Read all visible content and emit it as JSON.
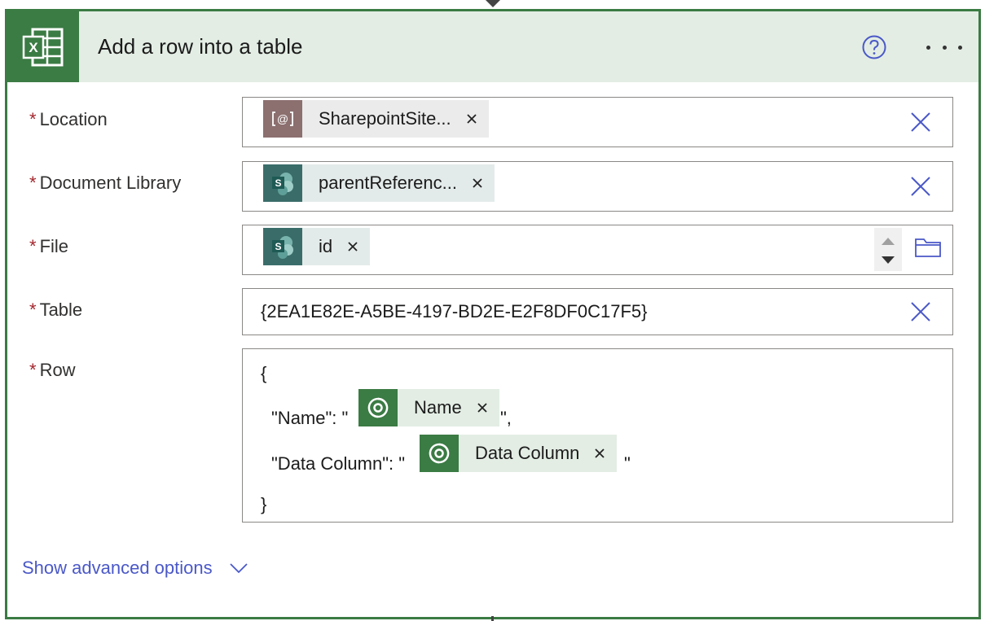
{
  "header": {
    "title": "Add a row into a table",
    "app_icon": "excel-icon",
    "help_icon": "help-circle-icon",
    "more_icon": "more-ellipsis-icon",
    "brand_color": "#3b7b44"
  },
  "required_marker": "*",
  "fields": {
    "location": {
      "label": "Location",
      "token": "SharepointSite...",
      "token_icon": "variable-icon"
    },
    "document_library": {
      "label": "Document Library",
      "token": "parentReferenc...",
      "token_icon": "sharepoint-icon"
    },
    "file": {
      "label": "File",
      "token": "id",
      "token_icon": "sharepoint-icon",
      "browse_icon": "folder-icon"
    },
    "table": {
      "label": "Table",
      "value": "{2EA1E82E-A5BE-4197-BD2E-E2F8DF0C17F5}"
    },
    "row": {
      "label": "Row",
      "open_brace": "{",
      "line1_prefix": "\"Name\": \"",
      "line1_token": "Name",
      "line1_suffix": "\",",
      "line2_prefix": "\"Data Column\": \"",
      "line2_token": "Data Column",
      "line2_suffix": "\"",
      "close_brace": "}",
      "token_icon": "dataverse-icon"
    }
  },
  "advanced": {
    "label": "Show advanced options",
    "icon": "chevron-down-icon"
  }
}
